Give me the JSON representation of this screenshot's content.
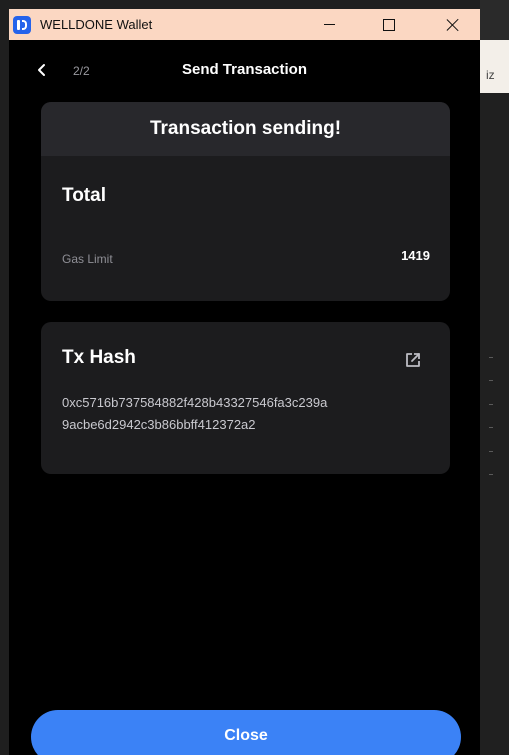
{
  "window": {
    "title": "WELLDONE Wallet",
    "title_bar_color": "#fbd7c2"
  },
  "background": {
    "partial_text": "iz"
  },
  "header": {
    "step": "2/2",
    "title": "Send Transaction"
  },
  "status_card": {
    "status_text": "Transaction sending!",
    "total_label": "Total",
    "gas_limit_label": "Gas Limit",
    "gas_limit_value": "1419"
  },
  "hash_card": {
    "label": "Tx Hash",
    "hash_line_1": "0xc5716b737584882f428b43327546fa3c239a",
    "hash_line_2": "9acbe6d2942c3b86bbff412372a2"
  },
  "footer": {
    "close_label": "Close",
    "accent_color": "#3b82f6"
  },
  "icons": {
    "back": "chevron-left-icon",
    "external_link": "external-link-icon",
    "app_logo": "welldone-logo"
  }
}
